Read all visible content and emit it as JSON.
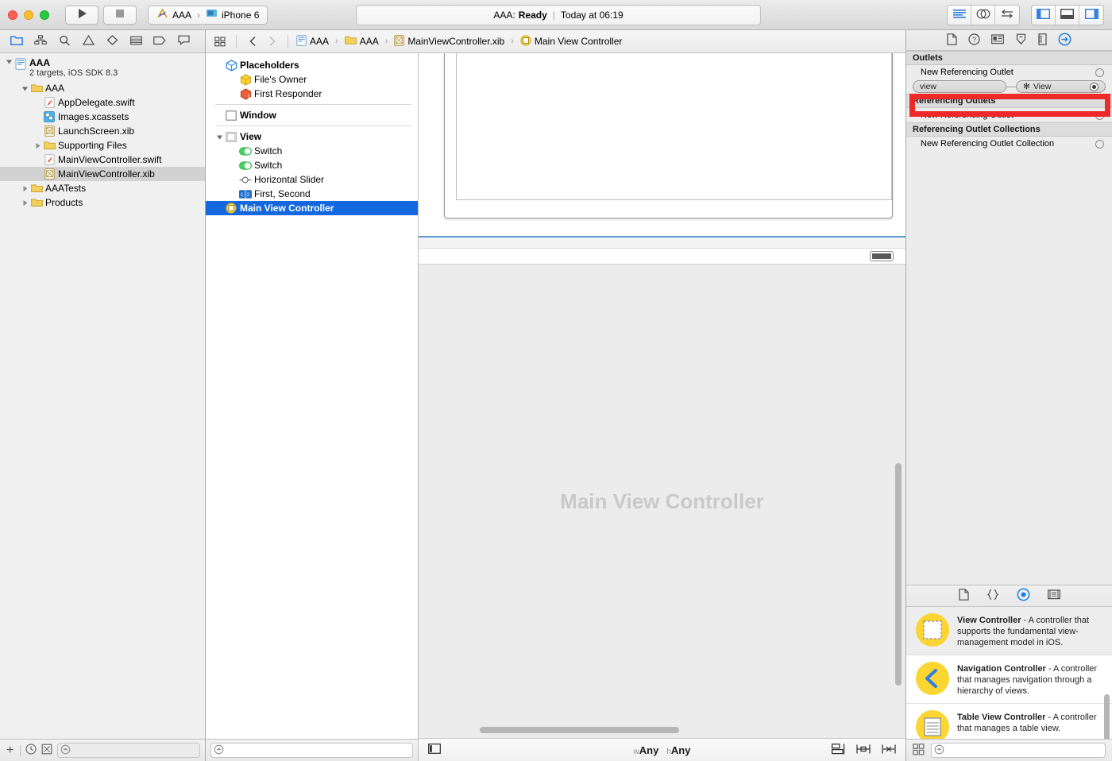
{
  "titlebar": {
    "run_icon": "play-icon",
    "stop_icon": "stop-icon",
    "scheme_name": "AAA",
    "scheme_separator": "›",
    "destination": "iPhone 6",
    "status_project": "AAA:",
    "status_state": "Ready",
    "status_divider": "|",
    "status_time": "Today at 06:19",
    "editor_modes": [
      "standard-editor-icon",
      "assistant-editor-icon",
      "version-editor-icon"
    ],
    "view_toggles": [
      "navigator-toggle-icon",
      "debug-area-toggle-icon",
      "utilities-toggle-icon"
    ]
  },
  "navigator": {
    "tabs": [
      "folder-icon",
      "sitemap-icon",
      "search-icon",
      "warning-icon",
      "diamond-icon",
      "test-icon",
      "tag-icon",
      "comment-icon"
    ],
    "project": {
      "name": "AAA",
      "subtitle": "2 targets, iOS SDK 8.3"
    },
    "items": [
      {
        "label": "AAA",
        "icon": "folder-icon",
        "indent": 1,
        "twisty": "open",
        "bold": false
      },
      {
        "label": "AppDelegate.swift",
        "icon": "swift-file-icon",
        "indent": 2,
        "twisty": "none"
      },
      {
        "label": "Images.xcassets",
        "icon": "assets-icon",
        "indent": 2,
        "twisty": "none"
      },
      {
        "label": "LaunchScreen.xib",
        "icon": "xib-file-icon",
        "indent": 2,
        "twisty": "none"
      },
      {
        "label": "Supporting Files",
        "icon": "folder-icon",
        "indent": 2,
        "twisty": "closed"
      },
      {
        "label": "MainViewController.swift",
        "icon": "swift-file-icon",
        "indent": 2,
        "twisty": "none"
      },
      {
        "label": "MainViewController.xib",
        "icon": "xib-file-icon",
        "indent": 2,
        "twisty": "none",
        "selected": true
      },
      {
        "label": "AAATests",
        "icon": "folder-icon",
        "indent": 1,
        "twisty": "closed"
      },
      {
        "label": "Products",
        "icon": "folder-icon",
        "indent": 1,
        "twisty": "closed"
      }
    ],
    "bottom": {
      "add_label": "+",
      "icons": [
        "recent-icon",
        "filter-icon"
      ],
      "filter_placeholder": ""
    }
  },
  "jumpbar": {
    "related_icon": "related-items-icon",
    "back_icon": "chevron-left-icon",
    "forward_icon": "chevron-right-icon",
    "crumbs": [
      {
        "label": "AAA",
        "icon": "project-icon"
      },
      {
        "label": "AAA",
        "icon": "folder-icon"
      },
      {
        "label": "MainViewController.xib",
        "icon": "xib-file-icon"
      },
      {
        "label": "Main View Controller",
        "icon": "view-controller-icon"
      }
    ],
    "separator": "›"
  },
  "outline": {
    "rows": [
      {
        "label": "Placeholders",
        "icon": "placeholder-cube-icon",
        "indent": 0,
        "bold": true
      },
      {
        "label": "File's Owner",
        "icon": "files-owner-icon",
        "indent": 1
      },
      {
        "label": "First Responder",
        "icon": "first-responder-icon",
        "indent": 1
      },
      {
        "divider": true
      },
      {
        "label": "Window",
        "icon": "window-icon",
        "indent": 0,
        "bold": true
      },
      {
        "divider": true
      },
      {
        "label": "View",
        "icon": "view-icon",
        "indent": 0,
        "bold": true,
        "twisty": "open"
      },
      {
        "label": "Switch",
        "icon": "switch-icon",
        "indent": 1
      },
      {
        "label": "Switch",
        "icon": "switch-icon",
        "indent": 1
      },
      {
        "label": "Horizontal Slider",
        "icon": "slider-icon",
        "indent": 1
      },
      {
        "label": "First, Second",
        "icon": "segmented-control-icon",
        "indent": 1
      },
      {
        "label": "Main View Controller",
        "icon": "view-controller-icon",
        "indent": 0,
        "selected": true,
        "bold": true
      }
    ],
    "search_placeholder": ""
  },
  "canvas": {
    "placeholder_label": "Main View Controller",
    "size_class": {
      "prefix_w": "w",
      "value_w": "Any",
      "prefix_h": "h",
      "value_h": "Any"
    },
    "bottom_left_icon": "document-outline-toggle-icon",
    "bottom_right_icons": [
      "align-icon",
      "pin-icon",
      "resolve-issues-icon"
    ]
  },
  "utilities": {
    "inspector_tabs": [
      "file-inspector-icon",
      "quick-help-icon",
      "identity-inspector-icon",
      "attributes-inspector-icon",
      "size-inspector-icon",
      "connections-inspector-icon"
    ],
    "active_inspector": "connections-inspector-icon",
    "sections": [
      {
        "title": "Outlets",
        "rows": [
          {
            "label": "New Referencing Outlet",
            "connected": false,
            "obscured": true
          }
        ],
        "connection": {
          "outlet_name": "view",
          "target_prefix": "✻",
          "target_name": "View",
          "connected": true
        }
      },
      {
        "title": "Referencing Outlets",
        "rows": [
          {
            "label": "New Referencing Outlet",
            "connected": false
          }
        ]
      },
      {
        "title": "Referencing Outlet Collections",
        "rows": [
          {
            "label": "New Referencing Outlet Collection",
            "connected": false
          }
        ]
      }
    ],
    "highlight": {
      "color": "#ef2828",
      "target": "view-outlet-connection"
    },
    "library_tabs": [
      "file-template-library-icon",
      "code-snippet-library-icon",
      "object-library-icon",
      "media-library-icon"
    ],
    "active_library": "object-library-icon",
    "library_items": [
      {
        "title": "View Controller",
        "description": " - A controller that supports the fundamental view-management model in iOS.",
        "icon": "view-controller-library-icon",
        "highlighted": true
      },
      {
        "title": "Navigation Controller",
        "description": " - A controller that manages navigation through a hierarchy of views.",
        "icon": "navigation-controller-library-icon"
      },
      {
        "title": "Table View Controller",
        "description": " - A controller that manages a table view.",
        "icon": "table-view-controller-library-icon"
      }
    ],
    "library_bottom": {
      "grid_icon": "grid-view-icon",
      "search_placeholder": ""
    }
  }
}
